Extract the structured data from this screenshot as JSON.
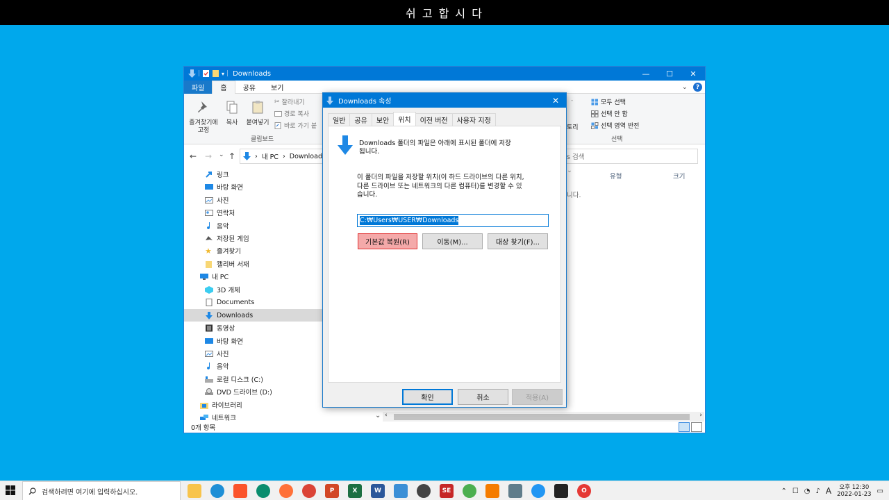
{
  "banner": {
    "title": "쉬 고 합 시 다"
  },
  "explorer": {
    "title": "Downloads",
    "window_controls": {
      "minimize": "—",
      "maximize": "☐",
      "close": "✕"
    },
    "ribbon_tabs": [
      "파일",
      "홈",
      "공유",
      "보기"
    ],
    "ribbon": {
      "pin_label_1": "즐겨찾기에",
      "pin_label_2": "고정",
      "copy": "복사",
      "paste": "붙여넣기",
      "cut": "잘라내기",
      "copy_path": "경로 복사",
      "paste_shortcut": "바로 가기 붙",
      "clipboard_group": "클립보드",
      "dash": "-",
      "folder_fragment": "토리",
      "select_all": "모두 선택",
      "select_none": "선택 안 함",
      "invert_selection": "선택 영역 반전",
      "select_group": "선택"
    },
    "address": {
      "my_pc": "내 PC",
      "current": "Downloads",
      "separator": "›"
    },
    "search_placeholder": "ds 검색",
    "nav_items": [
      {
        "label": "링크"
      },
      {
        "label": "바탕 화면"
      },
      {
        "label": "사진"
      },
      {
        "label": "연락처"
      },
      {
        "label": "음악"
      },
      {
        "label": "저장된 게임"
      },
      {
        "label": "즐겨찾기"
      },
      {
        "label": "캘리버 서재"
      },
      {
        "label": "내 PC"
      },
      {
        "label": "3D 개체"
      },
      {
        "label": "Documents"
      },
      {
        "label": "Downloads"
      },
      {
        "label": "동영상"
      },
      {
        "label": "바탕 화면"
      },
      {
        "label": "사진"
      },
      {
        "label": "음악"
      },
      {
        "label": "로컬 디스크 (C:)"
      },
      {
        "label": "DVD 드라이브 (D:)"
      },
      {
        "label": "라이브러리"
      },
      {
        "label": "네트워크"
      }
    ],
    "columns": {
      "type": "유형",
      "size": "크기"
    },
    "content_fragment": "니다.",
    "status": "0개 항목"
  },
  "dialog": {
    "title": "Downloads 속성",
    "close": "✕",
    "tabs": [
      "일반",
      "공유",
      "보안",
      "위치",
      "이전 버전",
      "사용자 지정"
    ],
    "active_tab": "위치",
    "desc_line1": "Downloads 폴더의 파일은 아래에 표시된 폴더에 저장",
    "desc_line2": "됩니다.",
    "info_line1": "이 폴더의 파일을 저장할 위치(이 하드 드라이브의 다른 위치,",
    "info_line2": "다른 드라이브 또는 네트워크의 다른 컴퓨터)를 변경할 수 있",
    "info_line3": "습니다.",
    "path_value": "C:₩Users₩USER₩Downloads",
    "btn_restore": "기본값 복원(R)",
    "btn_move": "이동(M)...",
    "btn_find": "대상 찾기(F)...",
    "btn_ok": "확인",
    "btn_cancel": "취소",
    "btn_apply": "적용(A)"
  },
  "taskbar": {
    "search_placeholder": "검색하려면 여기에 입력하십시오.",
    "ime": "A",
    "time": "오후 12:30",
    "date": "2022-01-23"
  },
  "colors": {
    "accent": "#0078d7",
    "desktop": "#00a8ec"
  }
}
